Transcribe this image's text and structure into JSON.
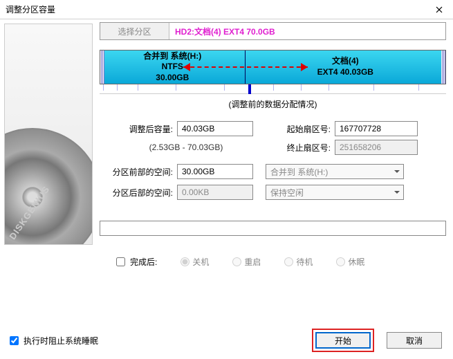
{
  "window": {
    "title": "调整分区容量"
  },
  "tabs": {
    "select": "选择分区",
    "active": "HD2:文档(4) EXT4 70.0GB"
  },
  "partitions": {
    "left": {
      "line1": "合并到 系统(H:)",
      "line2": "NTFS",
      "line3": "30.00GB"
    },
    "right": {
      "line1": "文档(4)",
      "line2": "EXT4 40.03GB"
    }
  },
  "preCaption": "(调整前的数据分配情况)",
  "form": {
    "afterSizeLabel": "调整后容量:",
    "afterSizeValue": "40.03GB",
    "startSectorLabel": "起始扇区号:",
    "startSectorValue": "167707728",
    "rangeHint": "(2.53GB - 70.03GB)",
    "endSectorLabel": "终止扇区号:",
    "endSectorValue": "251658206",
    "frontSpaceLabel": "分区前部的空间:",
    "frontSpaceValue": "30.00GB",
    "frontSelect": "合并到 系统(H:)",
    "backSpaceLabel": "分区后部的空间:",
    "backSpaceValue": "0.00KB",
    "backSelect": "保持空闲"
  },
  "after": {
    "label": "完成后:",
    "shutdown": "关机",
    "reboot": "重启",
    "standby": "待机",
    "hibernate": "休眠"
  },
  "footer": {
    "preventSleep": "执行时阻止系统睡眠",
    "start": "开始",
    "cancel": "取消"
  }
}
